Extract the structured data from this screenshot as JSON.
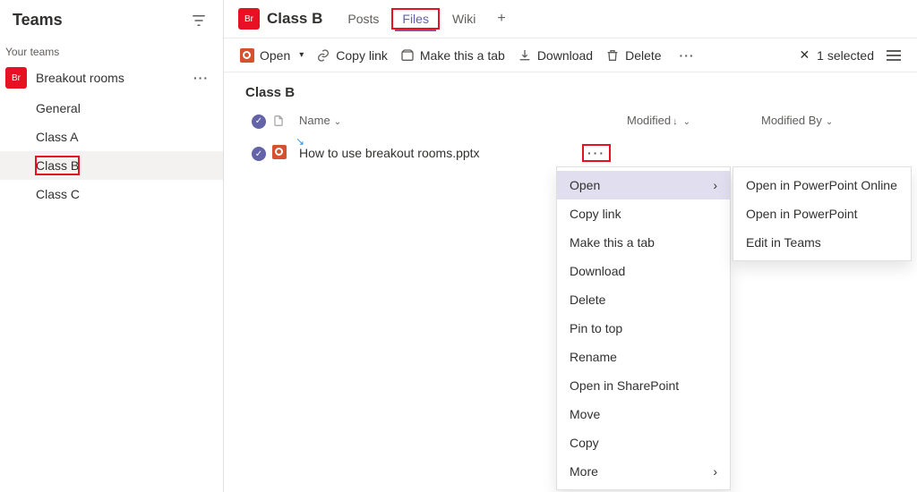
{
  "sidebar": {
    "title": "Teams",
    "section_label": "Your teams",
    "team": {
      "avatar_text": "Br",
      "name": "Breakout rooms"
    },
    "channels": [
      "General",
      "Class A",
      "Class B",
      "Class C"
    ],
    "selected_channel": "Class B"
  },
  "header": {
    "avatar_text": "Br",
    "title": "Class B",
    "tabs": [
      "Posts",
      "Files",
      "Wiki"
    ],
    "active_tab": "Files"
  },
  "toolbar": {
    "open": "Open",
    "copy_link": "Copy link",
    "make_tab": "Make this a tab",
    "download": "Download",
    "delete": "Delete",
    "selected_text": "1 selected"
  },
  "folder": {
    "title": "Class B"
  },
  "columns": {
    "name": "Name",
    "modified": "Modified",
    "modified_by": "Modified By"
  },
  "file": {
    "name": "How to use breakout rooms.pptx"
  },
  "context_menu": {
    "items": [
      "Open",
      "Copy link",
      "Make this a tab",
      "Download",
      "Delete",
      "Pin to top",
      "Rename",
      "Open in SharePoint",
      "Move",
      "Copy",
      "More"
    ],
    "hover": "Open"
  },
  "open_submenu": {
    "items": [
      "Open in PowerPoint Online",
      "Open in PowerPoint",
      "Edit in Teams"
    ]
  }
}
